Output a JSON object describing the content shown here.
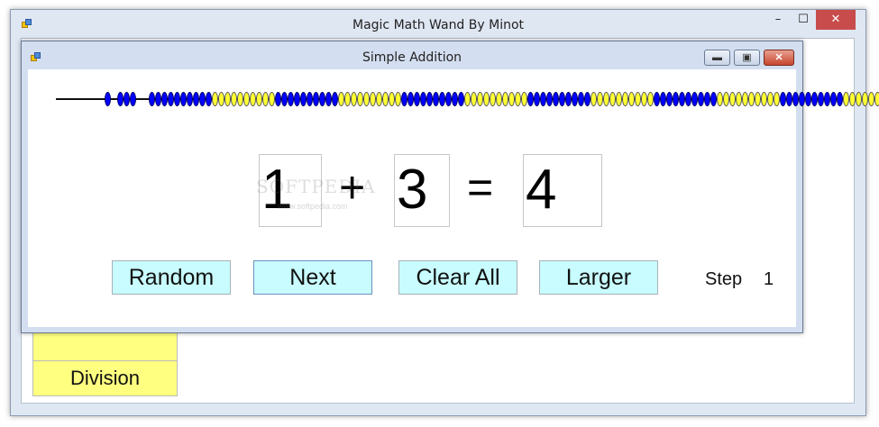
{
  "main_window": {
    "title": "Magic Math Wand By Minot",
    "controls": {
      "minimize": "–",
      "maximize": "☐",
      "close": "✕"
    },
    "menu_buttons": [
      {
        "label": ""
      },
      {
        "label": "Division"
      }
    ]
  },
  "child_window": {
    "title": "Simple Addition",
    "controls": {
      "minimize": "▬",
      "maximize": "▣",
      "close": "✕"
    },
    "bead_rack": {
      "left_markers": 4,
      "groups": [
        "blue",
        "yellow",
        "blue",
        "yellow",
        "blue",
        "yellow",
        "blue",
        "yellow",
        "blue",
        "yellow",
        "blue",
        "yellow"
      ],
      "beads_per_group": 10,
      "colors": {
        "blue": "#0000ff",
        "yellow": "#ffff33"
      }
    },
    "equation": {
      "operand_a": "1",
      "plus": "+",
      "operand_b": "3",
      "equals": "=",
      "result": "4"
    },
    "watermark": {
      "text": "SOFTPEDIA",
      "sub": "www.softpedia.com"
    },
    "buttons": {
      "random": "Random",
      "next": "Next",
      "clear_all": "Clear All",
      "larger": "Larger"
    },
    "step": {
      "label": "Step",
      "value": "1"
    }
  }
}
